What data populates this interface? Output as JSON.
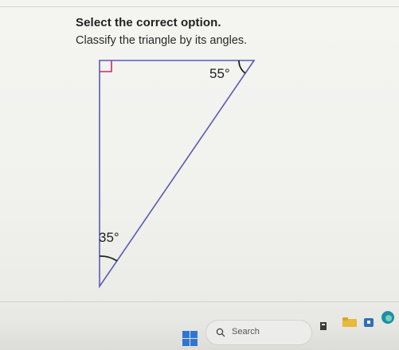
{
  "question": {
    "title": "Select the correct option.",
    "prompt": "Classify the triangle by its angles."
  },
  "figure": {
    "angle_top": "55°",
    "angle_bottom": "35°",
    "right_angle_marker": "right-angle-square"
  },
  "taskbar": {
    "search_label": "Search",
    "icons": [
      "windows-start-icon",
      "search-icon",
      "files-icon",
      "folder-icon",
      "store-icon",
      "edge-icon"
    ]
  },
  "colors": {
    "page_background": "#f2f2ef",
    "triangle_stroke": "#5b5bb0",
    "text": "#222222"
  }
}
